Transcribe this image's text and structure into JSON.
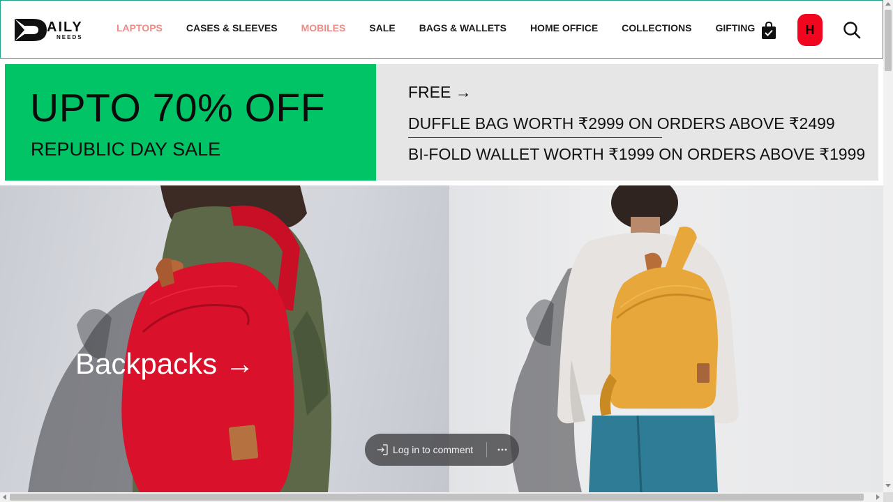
{
  "header": {
    "logo": {
      "word": "AILY",
      "sub": "NEEDS"
    },
    "nav": [
      {
        "label": "LAPTOPS",
        "color": "#ef8a84"
      },
      {
        "label": "CASES & SLEEVES",
        "color": "#1d1d1d"
      },
      {
        "label": "MOBILES",
        "color": "#ef8a84"
      },
      {
        "label": "SALE",
        "color": "#1d1d1d"
      },
      {
        "label": "BAGS & WALLETS",
        "color": "#1d1d1d"
      },
      {
        "label": "HOME OFFICE",
        "color": "#1d1d1d"
      },
      {
        "label": "COLLECTIONS",
        "color": "#1d1d1d"
      },
      {
        "label": "GIFTING",
        "color": "#1d1d1d"
      }
    ],
    "cart_icon": "shopping-bag-check-icon",
    "avatar_initial": "H",
    "avatar_color": "#f2061f",
    "search_icon": "search-icon",
    "border_color": "#1aa58a"
  },
  "promo": {
    "headline": "UPTO 70% OFF",
    "subheadline": "REPUBLIC DAY SALE",
    "free_label": "FREE →",
    "offer_1": "DUFFLE BAG WORTH ₹2999 ON ORDERS ABOVE ₹2499",
    "offer_2": "BI-FOLD WALLET WORTH ₹1999 ON ORDERS ABOVE ₹1999",
    "accent_color": "#00c466",
    "background_color": "#e6e6e6"
  },
  "hero": {
    "category_label": "Backpacks →",
    "left_backpack_color": "#d9112a",
    "right_backpack_color": "#e8a73a"
  },
  "comment_bar": {
    "login_label": "Log in to comment",
    "login_icon": "login-arrow-icon",
    "more_icon": "more-horizontal-icon"
  }
}
